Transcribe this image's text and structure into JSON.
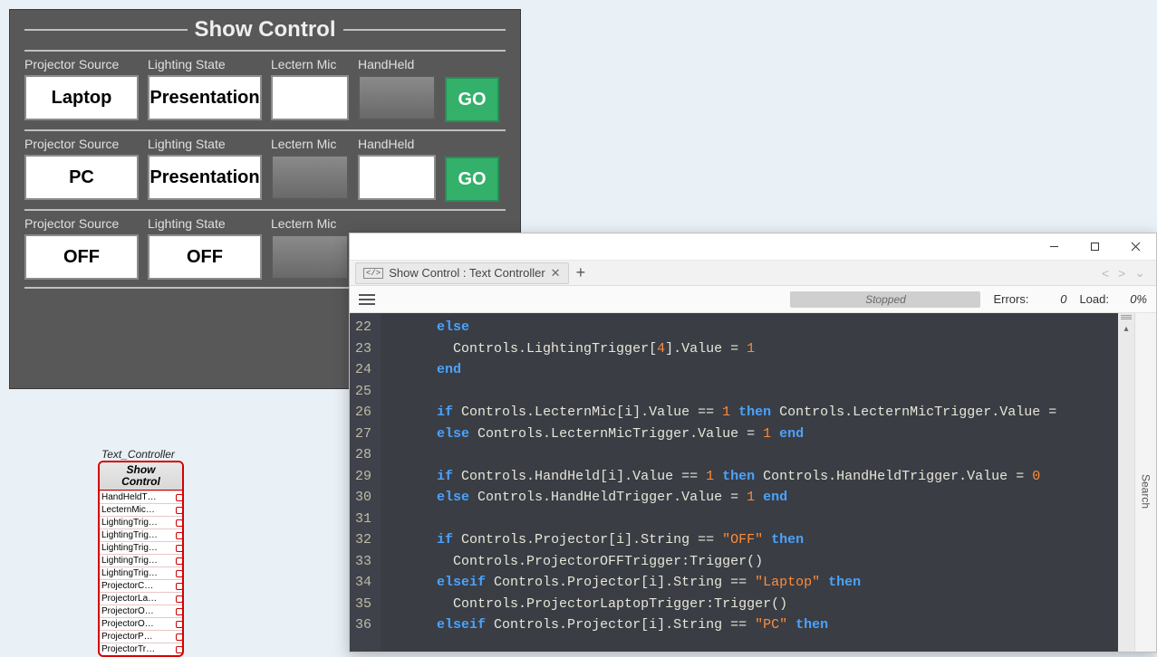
{
  "panel": {
    "title": "Show Control",
    "columns": [
      "Projector Source",
      "Lighting State",
      "Lectern Mic",
      "HandHeld"
    ],
    "go_label": "GO",
    "rows": [
      {
        "projector": "Laptop",
        "lighting": "Presentation",
        "lectern": "",
        "handheld": "",
        "lectern_dim": false,
        "handheld_dim": true,
        "show_go": true,
        "show_handheld": true
      },
      {
        "projector": "PC",
        "lighting": "Presentation",
        "lectern": "",
        "handheld": "",
        "lectern_dim": true,
        "handheld_dim": false,
        "show_go": true,
        "show_handheld": true
      },
      {
        "projector": "OFF",
        "lighting": "OFF",
        "lectern": "",
        "handheld": "",
        "lectern_dim": true,
        "handheld_dim": true,
        "show_go": false,
        "show_handheld": false
      }
    ]
  },
  "node": {
    "caption": "Text_Controller",
    "head_line1": "Show",
    "head_line2": "Control",
    "pins": [
      {
        "label": "HandHeldT…",
        "tag": "Hand"
      },
      {
        "label": "LecternMic…",
        "tag": "LecternMic"
      },
      {
        "label": "LightingTrig…",
        "tag": null
      },
      {
        "label": "LightingTrig…",
        "tag": "LX1"
      },
      {
        "label": "LightingTrig…",
        "tag": "LX2"
      },
      {
        "label": "LightingTrig…",
        "tag": "LX3"
      },
      {
        "label": "LightingTrig…",
        "tag": "LX4"
      },
      {
        "label": "ProjectorC…",
        "tag": "ProjCam"
      },
      {
        "label": "ProjectorLa…",
        "tag": "ProjLaptop"
      },
      {
        "label": "ProjectorO…",
        "tag": "ProjOff"
      },
      {
        "label": "ProjectorO…",
        "tag": "ProjOn"
      },
      {
        "label": "ProjectorP…",
        "tag": "ProjPC"
      },
      {
        "label": "ProjectorTr…",
        "tag": null
      }
    ]
  },
  "editor": {
    "tab_title": "Show Control : Text Controller",
    "status": "Stopped",
    "errors_label": "Errors:",
    "errors_value": "0",
    "load_label": "Load:",
    "load_value": "0%",
    "search_label": "Search",
    "line_start": 22,
    "lines": [
      {
        "indent": 3,
        "tokens": [
          [
            "kw",
            "else"
          ]
        ]
      },
      {
        "indent": 4,
        "tokens": [
          [
            "pale",
            "Controls.LightingTrigger["
          ],
          [
            "num",
            "4"
          ],
          [
            "pale",
            "].Value = "
          ],
          [
            "num",
            "1"
          ]
        ]
      },
      {
        "indent": 3,
        "tokens": [
          [
            "kw",
            "end"
          ]
        ]
      },
      {
        "indent": 0,
        "tokens": []
      },
      {
        "indent": 3,
        "tokens": [
          [
            "kw",
            "if"
          ],
          [
            "pale",
            " Controls.LecternMic[i].Value == "
          ],
          [
            "num",
            "1"
          ],
          [
            "pale",
            " "
          ],
          [
            "kw",
            "then"
          ],
          [
            "pale",
            " Controls.LecternMicTrigger.Value ="
          ]
        ]
      },
      {
        "indent": 3,
        "tokens": [
          [
            "kw",
            "else"
          ],
          [
            "pale",
            " Controls.LecternMicTrigger.Value = "
          ],
          [
            "num",
            "1"
          ],
          [
            "pale",
            " "
          ],
          [
            "kw",
            "end"
          ]
        ]
      },
      {
        "indent": 0,
        "tokens": []
      },
      {
        "indent": 3,
        "tokens": [
          [
            "kw",
            "if"
          ],
          [
            "pale",
            " Controls.HandHeld[i].Value == "
          ],
          [
            "num",
            "1"
          ],
          [
            "pale",
            " "
          ],
          [
            "kw",
            "then"
          ],
          [
            "pale",
            " Controls.HandHeldTrigger.Value = "
          ],
          [
            "num",
            "0"
          ]
        ]
      },
      {
        "indent": 3,
        "tokens": [
          [
            "kw",
            "else"
          ],
          [
            "pale",
            " Controls.HandHeldTrigger.Value = "
          ],
          [
            "num",
            "1"
          ],
          [
            "pale",
            " "
          ],
          [
            "kw",
            "end"
          ]
        ]
      },
      {
        "indent": 0,
        "tokens": []
      },
      {
        "indent": 3,
        "tokens": [
          [
            "kw",
            "if"
          ],
          [
            "pale",
            " Controls.Projector[i].String == "
          ],
          [
            "str",
            "\"OFF\""
          ],
          [
            "pale",
            " "
          ],
          [
            "kw",
            "then"
          ]
        ]
      },
      {
        "indent": 4,
        "tokens": [
          [
            "pale",
            "Controls.ProjectorOFFTrigger:Trigger()"
          ]
        ]
      },
      {
        "indent": 3,
        "tokens": [
          [
            "kw",
            "elseif"
          ],
          [
            "pale",
            " Controls.Projector[i].String == "
          ],
          [
            "str",
            "\"Laptop\""
          ],
          [
            "pale",
            " "
          ],
          [
            "kw",
            "then"
          ]
        ]
      },
      {
        "indent": 4,
        "tokens": [
          [
            "pale",
            "Controls.ProjectorLaptopTrigger:Trigger()"
          ]
        ]
      },
      {
        "indent": 3,
        "tokens": [
          [
            "kw",
            "elseif"
          ],
          [
            "pale",
            " Controls.Projector[i].String == "
          ],
          [
            "str",
            "\"PC\""
          ],
          [
            "pale",
            " "
          ],
          [
            "kw",
            "then"
          ]
        ]
      }
    ]
  }
}
